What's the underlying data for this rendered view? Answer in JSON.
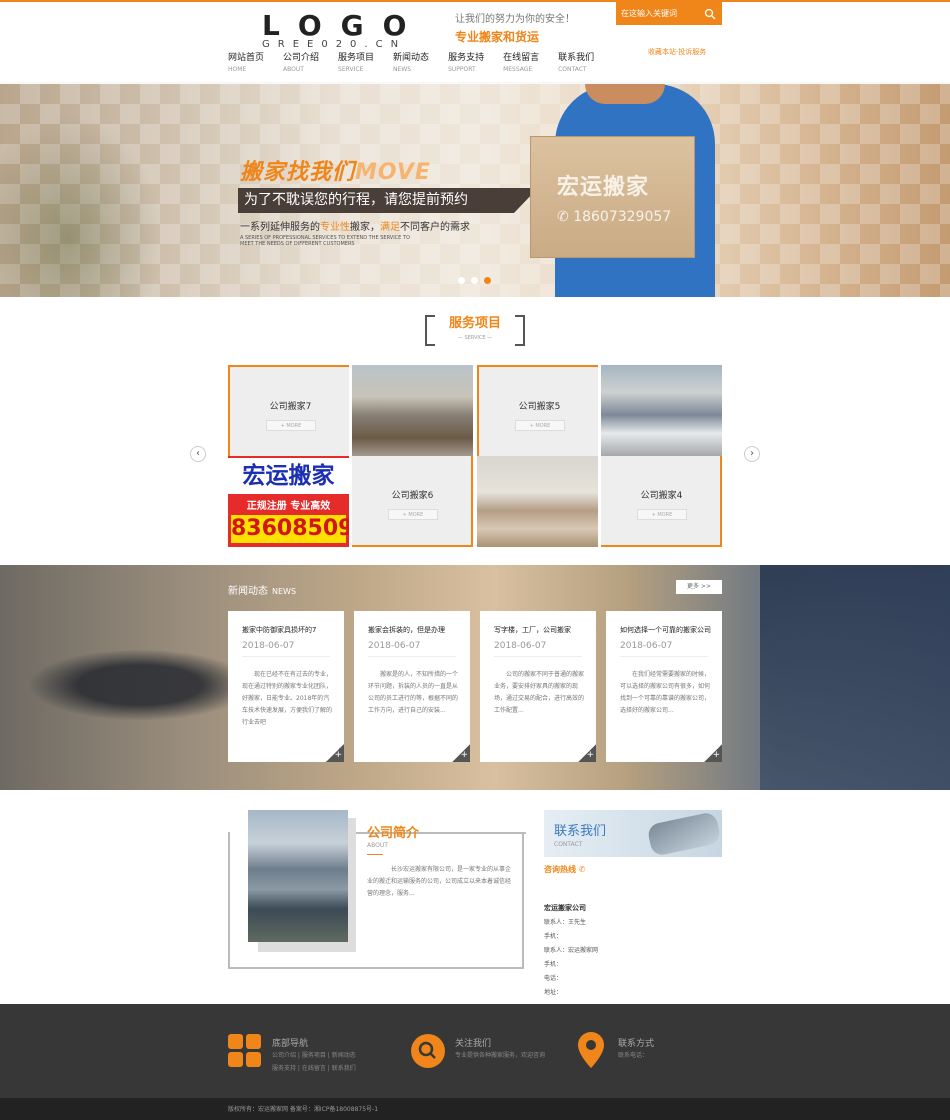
{
  "header": {
    "logo_big": "LOGO",
    "logo_small": "GREE020.CN",
    "slogan_line1": "让我们的努力为你的安全！",
    "slogan_line2": "专业搬家和货运",
    "search_placeholder": "在这输入关键词",
    "favorite_text": "收藏本站·投诉服务",
    "nav": [
      {
        "cn": "网站首页",
        "en": "HOME"
      },
      {
        "cn": "公司介绍",
        "en": "ABOUT"
      },
      {
        "cn": "服务项目",
        "en": "SERVICE"
      },
      {
        "cn": "新闻动态",
        "en": "NEWS"
      },
      {
        "cn": "服务支持",
        "en": "SUPPORT"
      },
      {
        "cn": "在线留言",
        "en": "MESSAGE"
      },
      {
        "cn": "联系我们",
        "en": "CONTACT"
      }
    ]
  },
  "banner": {
    "title": "搬家找我们",
    "title_en": "MOVE",
    "strip": "为了不耽误您的行程，请您提前预约",
    "line3_a": "一系列延伸服务的",
    "line3_b": "专业性",
    "line3_c": "搬家，",
    "line3_d": "满足",
    "line3_e": "不同客户的需求",
    "line4": "A SERIES OF PROFESSIONAL SERVICES TO EXTEND THE SERVICE TO MEET THE NEEDS OF DIFFERENT CUSTOMERS",
    "box_name": "宏运搬家",
    "box_phone": "18607329057"
  },
  "service": {
    "title": "服务项目",
    "en": "SERVICE",
    "items": [
      {
        "label": "公司搬家7",
        "more": "+ MORE"
      },
      {
        "label": "公司搬家5",
        "more": "+ MORE"
      },
      {
        "label": "公司搬家6",
        "more": "+ MORE"
      },
      {
        "label": "公司搬家4",
        "more": "+ MORE"
      }
    ],
    "ad": {
      "name": "宏运搬家",
      "tag": "正规注册 专业高效",
      "phone": "83608509"
    }
  },
  "news": {
    "title": "新闻动态",
    "en": "NEWS",
    "more": "更多 >>",
    "cards": [
      {
        "title": "搬家中防御家具损坏的7",
        "date": "2018-06-07",
        "body": "现在已经不在有过去的专业，现在通过特别的搬家专业化团队，好搬家，日能专业。2018年的汽车技术快速发展，方便我们了解的行业去吧"
      },
      {
        "title": "搬家会拆装的，但是办理",
        "date": "2018-06-07",
        "body": "搬家是的人，不知所措的一个环节问题，拆装的人员的一直是从公司的员工进行的等，根据不同的工作方向，进行自己的安装..."
      },
      {
        "title": "写字楼，工厂，公司搬家",
        "date": "2018-06-07",
        "body": "公司的搬家不同于普通的搬家业务，要安排好家具的搬家的现场，通过交易的配合，进行高效的工作配置..."
      },
      {
        "title": "如何选择一个可靠的搬家公司",
        "date": "2018-06-07",
        "body": "在我们经常需要搬家的时候，可以选择的搬家公司有很多，如何找到一个可靠的靠谱的搬家公司，选择好的搬家公司..."
      }
    ]
  },
  "about": {
    "title": "公司简介",
    "en": "ABOUT",
    "text": "长沙宏运搬家有限公司，是一家专业的从事企业的搬迁和运输服务的公司，公司成立以来本着诚信经营的理念，服务..."
  },
  "contact": {
    "title": "联系我们",
    "en": "CONTACT",
    "hotline": "咨询热线",
    "company": "宏运搬家公司",
    "lines": [
      "联系人：王先生",
      "手机：",
      "联系人：宏运搬家网",
      "手机：",
      "电话：",
      "地址："
    ]
  },
  "footer": {
    "col1_title": "底部导航",
    "col1_links": [
      "公司介绍",
      "服务项目",
      "新闻动态",
      "服务支持",
      "在线留言",
      "联系我们"
    ],
    "col2_title": "关注我们",
    "col2_text": "专业提供各种搬家服务，欢迎咨询",
    "col3_title": "联系方式",
    "col3_text": "联系电话：",
    "copyright": "版权所有：宏运搬家网    备案号：湘ICP备18008875号-1"
  },
  "colors": {
    "accent": "#f08519",
    "dark": "#373737"
  }
}
